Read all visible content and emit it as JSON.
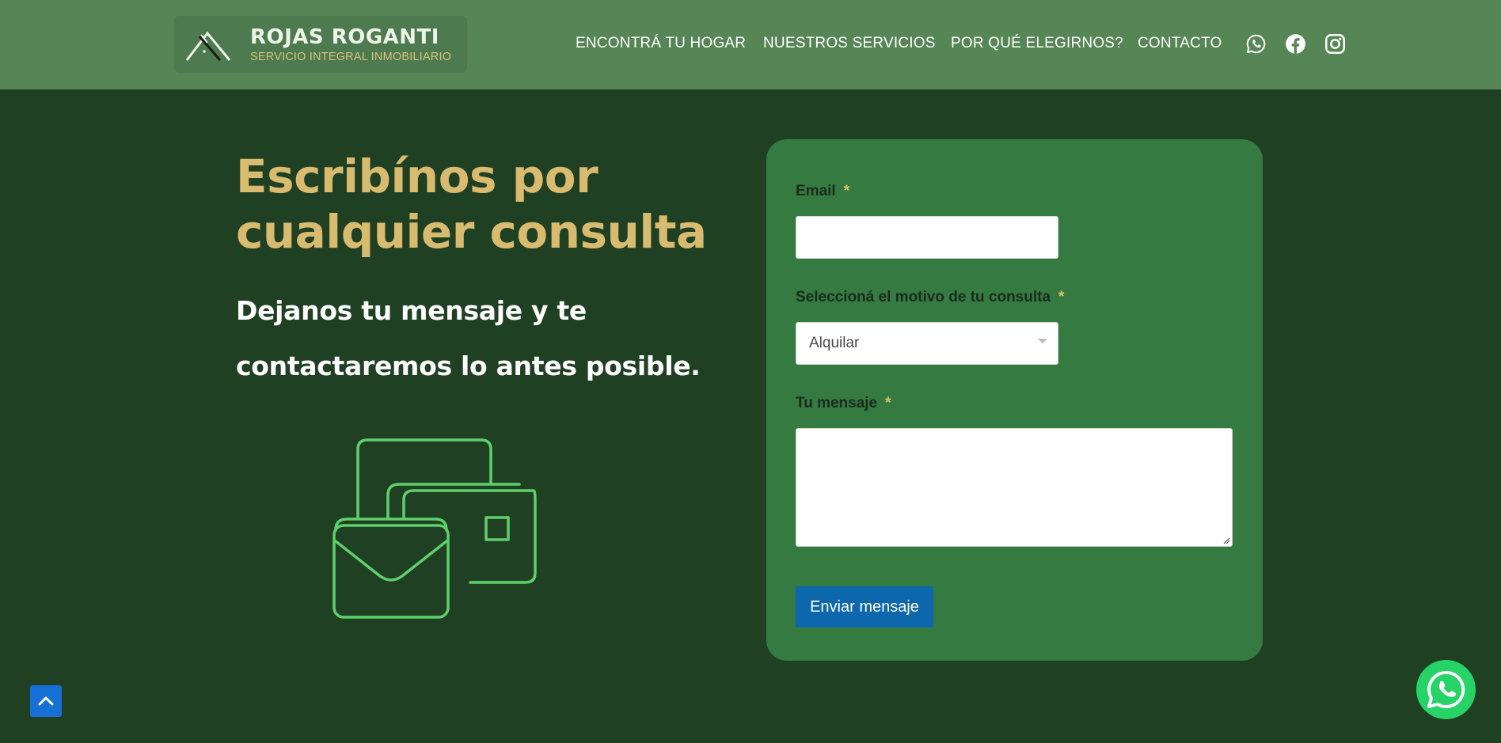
{
  "brand": {
    "name": "ROJAS ROGANTI",
    "tagline": "SERVICIO INTEGRAL INMOBILIARIO"
  },
  "nav": {
    "items": [
      {
        "label": "ENCONTRÁ TU HOGAR"
      },
      {
        "label": "NUESTROS SERVICIOS"
      },
      {
        "label": "POR QUÉ ELEGIRNOS?"
      },
      {
        "label": "CONTACTO"
      }
    ],
    "social_icons": [
      "whatsapp-icon",
      "facebook-icon",
      "instagram-icon"
    ]
  },
  "hero": {
    "headline_line1": "Escribínos por",
    "headline_line2": "cualquier consulta",
    "subhead_line1": "Dejanos tu mensaje y te",
    "subhead_line2": "contactaremos lo antes posible.",
    "illustration_icon": "contact-cards-envelope-icon"
  },
  "form": {
    "email_label": "Email",
    "email_value": "",
    "reason_label": "Seleccioná el motivo de tu consulta",
    "reason_selected": "Alquilar",
    "message_label": "Tu mensaje",
    "message_value": "",
    "required_mark": "*",
    "submit_label": "Enviar mensaje"
  },
  "colors": {
    "header_bg": "#578656",
    "page_bg": "#1f4023",
    "card_bg": "#347a41",
    "headline": "#d9bb70",
    "accent_gold": "#e1c45b",
    "button_blue": "#0d67ad",
    "whatsapp_green": "#25d366",
    "illustration_green": "#5fd06c"
  }
}
